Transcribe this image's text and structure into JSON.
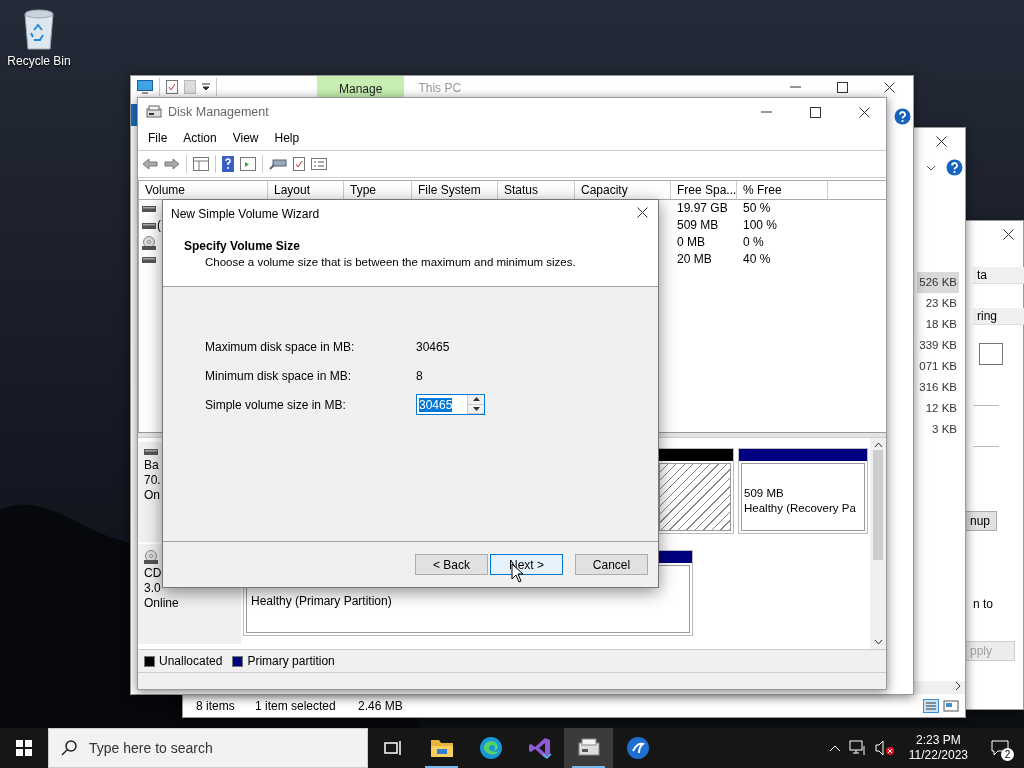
{
  "desktop": {
    "icons": [
      {
        "kind": "recycle-bin",
        "label": "Recycle Bin"
      }
    ]
  },
  "side_window": {
    "column_headers": [
      "ta",
      "ring"
    ],
    "buttons": [
      {
        "label": "nup",
        "disabled": false
      },
      {
        "label": "pply",
        "disabled": true
      }
    ],
    "note": "n to"
  },
  "back_window": {
    "size_column": [
      {
        "value": "526 KB",
        "selected": true
      },
      {
        "value": "23 KB",
        "selected": false
      },
      {
        "value": "18 KB",
        "selected": false
      },
      {
        "value": "339 KB",
        "selected": false
      },
      {
        "value": "071 KB",
        "selected": false
      },
      {
        "value": "316 KB",
        "selected": false
      },
      {
        "value": "12 KB",
        "selected": false
      },
      {
        "value": "3 KB",
        "selected": false
      }
    ],
    "status_bar": {
      "item_count": "8 items",
      "selection": "1 item selected",
      "selection_size": "2.46 MB"
    }
  },
  "explorer_window": {
    "context_tab": {
      "label": "Manage",
      "selected": true
    },
    "title": "This PC"
  },
  "disk_management": {
    "title": "Disk Management",
    "menu": [
      "File",
      "Action",
      "View",
      "Help"
    ],
    "columns": [
      "Volume",
      "Layout",
      "Type",
      "File System",
      "Status",
      "Capacity",
      "Free Spa...",
      "% Free"
    ],
    "rows": [
      {
        "kind": "disk",
        "free_space": "19.97 GB",
        "percent_free": "50 %"
      },
      {
        "kind": "disk",
        "volume": "(",
        "free_space": "509 MB",
        "percent_free": "100 %"
      },
      {
        "kind": "cd",
        "free_space": "0 MB",
        "percent_free": "0 %"
      },
      {
        "kind": "disk",
        "free_space": "20 MB",
        "percent_free": "40 %"
      }
    ],
    "disks": [
      {
        "kind": "disk",
        "label_lines": [
          "Ba",
          "70.",
          "On"
        ],
        "partitions": [
          {
            "kind": "unallocated"
          },
          {
            "kind": "primary",
            "size": "509 MB",
            "status": "Healthy (Recovery Pa"
          }
        ]
      },
      {
        "kind": "cd",
        "label_lines": [
          "CD",
          "3.0",
          "Online"
        ],
        "partitions": [
          {
            "kind": "primary",
            "status": "Healthy (Primary Partition)"
          }
        ]
      }
    ],
    "legend": [
      {
        "label": "Unallocated",
        "color": "#000000"
      },
      {
        "label": "Primary partition",
        "color": "#000080"
      }
    ]
  },
  "wizard": {
    "title": "New Simple Volume Wizard",
    "heading": "Specify Volume Size",
    "subheading": "Choose a volume size that is between the maximum and minimum sizes.",
    "fields": [
      {
        "kind": "readout",
        "label": "Maximum disk space in MB:",
        "value": "30465"
      },
      {
        "kind": "readout",
        "label": "Minimum disk space in MB:",
        "value": "8"
      },
      {
        "kind": "spinner",
        "label": "Simple volume size in MB:",
        "value": "30465",
        "text_selected": true
      }
    ],
    "buttons": [
      {
        "label": "< Back",
        "focused": false
      },
      {
        "label": "Next >",
        "focused": true
      },
      {
        "label": "Cancel",
        "focused": false
      }
    ]
  },
  "taskbar": {
    "search_placeholder": "Type here to search",
    "apps": [
      {
        "kind": "task-view",
        "selected": false,
        "running": false
      },
      {
        "kind": "folder",
        "selected": false,
        "running": true
      },
      {
        "kind": "edge",
        "selected": false,
        "running": false
      },
      {
        "kind": "visual-studio",
        "selected": false,
        "running": false
      },
      {
        "kind": "disk-management",
        "selected": true,
        "running": true
      },
      {
        "kind": "app",
        "selected": false,
        "running": false
      }
    ],
    "volume_muted": true,
    "clock": {
      "time": "2:23 PM",
      "date": "11/22/2023"
    },
    "notification_count": "2"
  }
}
